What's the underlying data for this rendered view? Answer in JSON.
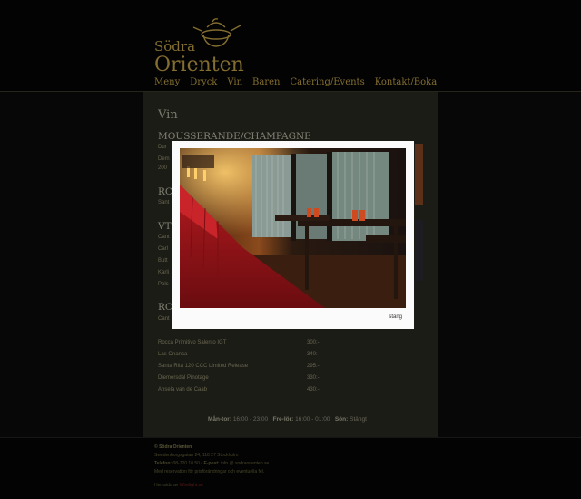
{
  "logo": {
    "line1": "Södra",
    "line2": "Orienten"
  },
  "nav": [
    "Meny",
    "Dryck",
    "Vin",
    "Baren",
    "Catering/Events",
    "Kontakt/Boka"
  ],
  "page": {
    "title": "Vin"
  },
  "sections": {
    "s1": "MOUSSERANDE/CHAMPAGNE",
    "s2": "RC",
    "s3": "VT",
    "s4": "RC"
  },
  "wines_partial": [
    {
      "name": "Dur",
      "price": ""
    },
    {
      "name": "Dem",
      "price": ""
    },
    {
      "name": "200",
      "price": ""
    },
    {
      "name": "Sant",
      "price": ""
    },
    {
      "name": "Cant",
      "price": ""
    },
    {
      "name": "Carl",
      "price": ""
    },
    {
      "name": "Butt",
      "price": ""
    },
    {
      "name": "Karli",
      "price": ""
    },
    {
      "name": "Pols",
      "price": ""
    },
    {
      "name": "Cant",
      "price": ""
    }
  ],
  "wines": [
    {
      "name": "Rocca Primitivo Salento IGT",
      "price": "300:-"
    },
    {
      "name": "Las Onanca",
      "price": "340:-"
    },
    {
      "name": "Santa Rita 120 CCC Limited Release",
      "price": "295:-"
    },
    {
      "name": "Diemersdal Pinotage",
      "price": "330:-"
    },
    {
      "name": "Ansela van de Caab",
      "price": "430:-"
    }
  ],
  "hours": {
    "d1": "Mån-tor:",
    "t1": "16:00 - 23:00",
    "d2": "Fre-lör:",
    "t2": "16:00 - 01:00",
    "d3": "Sön:",
    "t3": "Stängt"
  },
  "footer": {
    "name": "© Södra Orienten",
    "address": "Swedenborgsgatan 24, 118 27 Stockholm",
    "phone_label": "Telefon:",
    "phone": "08-720 10 50",
    "email_label": "E-post:",
    "email": "info @ sodraorienten.se",
    "note": "Med reservation för prisförändringar och eventuella fel.",
    "credit_label": "Hemsida av",
    "credit": "Wirelight.se"
  },
  "lightbox": {
    "close_label": "stäng"
  },
  "colors": {
    "gold": "#c9a84a",
    "panel": "#2c2c24",
    "background": "#000000"
  }
}
